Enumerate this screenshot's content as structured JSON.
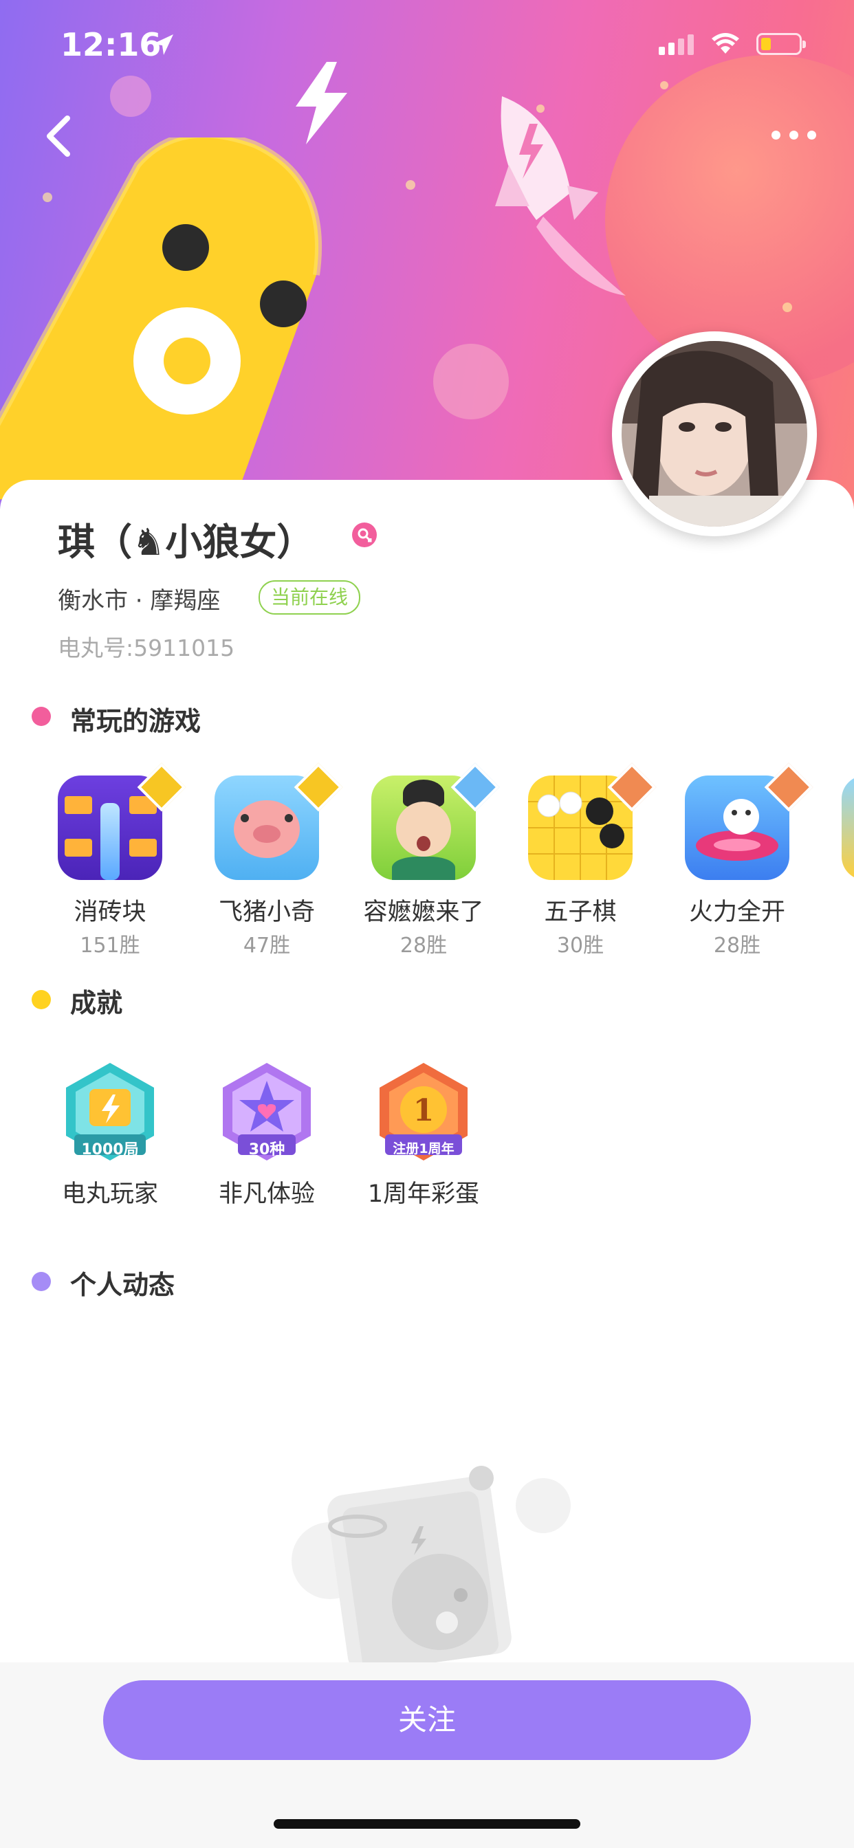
{
  "status_bar": {
    "time": "12:16"
  },
  "profile": {
    "name": "琪（♞小狼女）",
    "location_zodiac": "衡水市 · 摩羯座",
    "online_badge": "当前在线",
    "id_label": "电丸号:5911015",
    "gender_icon": "female-icon"
  },
  "sections": {
    "games_title": "常玩的游戏",
    "achievements_title": "成就",
    "feed_title": "个人动态"
  },
  "games": [
    {
      "name": "消砖块",
      "wins": "151胜"
    },
    {
      "name": "飞猪小奇",
      "wins": "47胜"
    },
    {
      "name": "容嬷嬷来了",
      "wins": "28胜"
    },
    {
      "name": "五子棋",
      "wins": "30胜"
    },
    {
      "name": "火力全开",
      "wins": "28胜"
    }
  ],
  "achievements": [
    {
      "name": "电丸玩家",
      "badge_text": "1000局"
    },
    {
      "name": "非凡体验",
      "badge_text": "30种"
    },
    {
      "name": "1周年彩蛋",
      "badge_text": "注册1周年"
    }
  ],
  "footer": {
    "follow_label": "关注"
  },
  "colors": {
    "accent": "#9b7cf6",
    "games_dot": "#f25e9c",
    "achievements_dot": "#ffd21f",
    "feed_dot": "#a58cf6",
    "online_green": "#8fd14f"
  }
}
